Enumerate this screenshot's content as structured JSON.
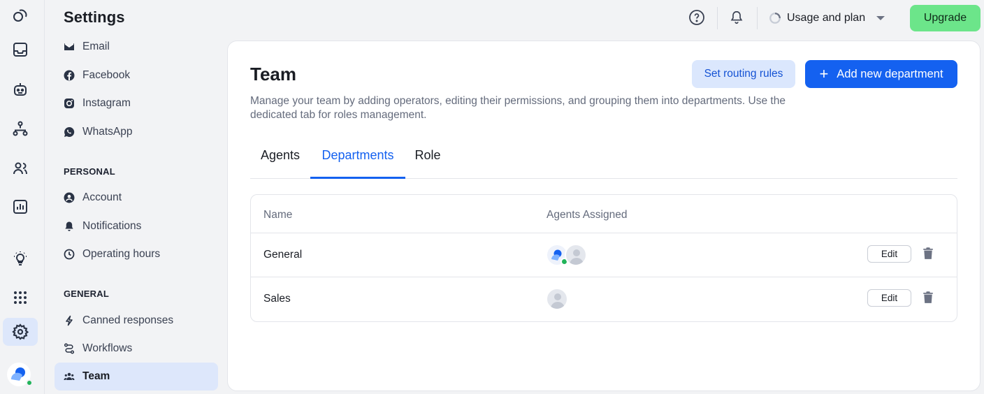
{
  "rail": {
    "icons": [
      "overview-icon",
      "inbox-icon",
      "chatbot-icon",
      "flows-icon",
      "contacts-icon",
      "analytics-icon",
      "ideas-icon",
      "apps-icon",
      "settings-icon"
    ]
  },
  "nav": {
    "title": "Settings",
    "channels": [
      {
        "label": "Email",
        "icon": "email-icon"
      },
      {
        "label": "Facebook",
        "icon": "facebook-icon"
      },
      {
        "label": "Instagram",
        "icon": "instagram-icon"
      },
      {
        "label": "WhatsApp",
        "icon": "whatsapp-icon"
      }
    ],
    "personal_heading": "PERSONAL",
    "personal": [
      {
        "label": "Account",
        "icon": "account-icon"
      },
      {
        "label": "Notifications",
        "icon": "bell-icon"
      },
      {
        "label": "Operating hours",
        "icon": "clock-icon"
      }
    ],
    "general_heading": "GENERAL",
    "general": [
      {
        "label": "Canned responses",
        "icon": "bolt-icon"
      },
      {
        "label": "Workflows",
        "icon": "workflow-icon"
      },
      {
        "label": "Team",
        "icon": "team-icon"
      }
    ]
  },
  "header": {
    "usage_label": "Usage and plan",
    "upgrade_label": "Upgrade"
  },
  "page": {
    "title": "Team",
    "routing_button": "Set routing rules",
    "add_button": "Add new department",
    "description": "Manage your team by adding operators, editing their permissions, and grouping them into departments. Use the dedicated tab for roles management.",
    "tabs": [
      {
        "label": "Agents",
        "active": false
      },
      {
        "label": "Departments",
        "active": true
      },
      {
        "label": "Role",
        "active": false
      }
    ],
    "table": {
      "columns": [
        "Name",
        "Agents Assigned"
      ],
      "rows": [
        {
          "name": "General",
          "agents": 2,
          "edit_label": "Edit"
        },
        {
          "name": "Sales",
          "agents": 1,
          "edit_label": "Edit"
        }
      ]
    }
  },
  "colors": {
    "accent": "#1461f0",
    "upgrade": "#6ce58a",
    "online": "#22b45a",
    "active_bg": "#dde7fb"
  }
}
